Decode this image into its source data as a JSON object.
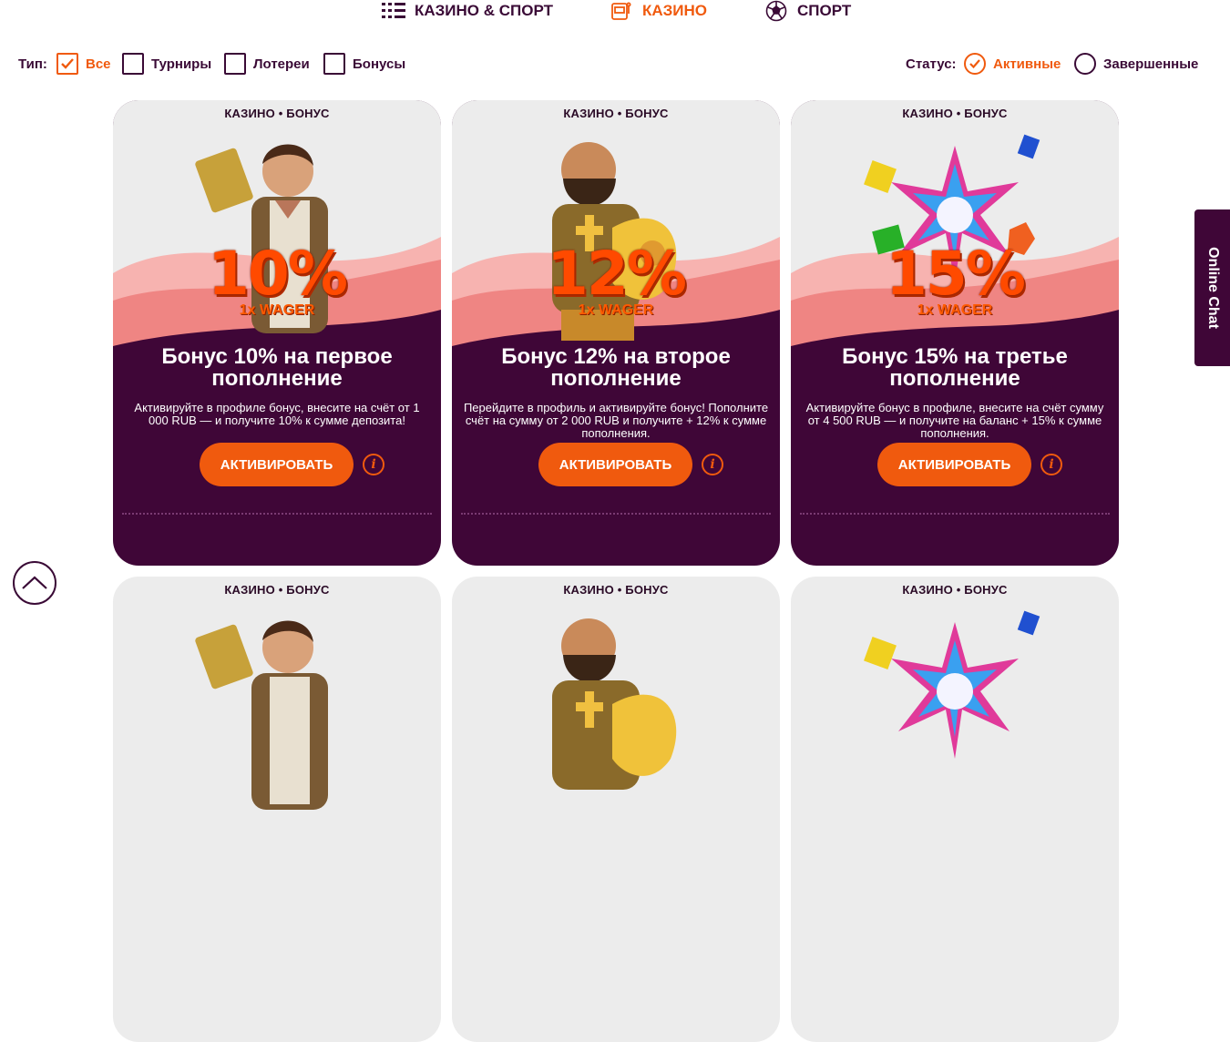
{
  "nav": {
    "items": [
      {
        "label": "КАЗИНО & СПОРТ",
        "icon": "grid-list-icon",
        "active": false
      },
      {
        "label": "КАЗИНО",
        "icon": "slot-machine-icon",
        "active": true
      },
      {
        "label": "СПОРТ",
        "icon": "soccer-ball-icon",
        "active": false
      }
    ]
  },
  "filters": {
    "type_label": "Тип:",
    "types": [
      {
        "label": "Все",
        "checked": true
      },
      {
        "label": "Турниры",
        "checked": false
      },
      {
        "label": "Лотереи",
        "checked": false
      },
      {
        "label": "Бонусы",
        "checked": false
      }
    ],
    "status_label": "Статус:",
    "statuses": [
      {
        "label": "Активные",
        "checked": true
      },
      {
        "label": "Завершенные",
        "checked": false
      }
    ]
  },
  "cards": [
    {
      "category": "КАЗИНО • БОНУС",
      "percent": "10%",
      "wager": "1x WAGER",
      "title": "Бонус 10% на первое пополнение",
      "description": "Активируйте в профиле бонус, внесите на счёт от 1 000 RUB — и получите 10% к сумме депозита!",
      "button": "АКТИВИРОВАТЬ",
      "art": "adventurer-icon"
    },
    {
      "category": "КАЗИНО • БОНУС",
      "percent": "12%",
      "wager": "1x WAGER",
      "title": "Бонус 12% на второе пополнение",
      "description": "Перейдите в профиль и активируйте бонус! Пополните счёт на сумму от 2 000 RUB и получите + 12% к сумме пополнения.",
      "button": "АКТИВИРОВАТЬ",
      "art": "dwarf-gold-icon"
    },
    {
      "category": "КАЗИНО • БОНУС",
      "percent": "15%",
      "wager": "1x WAGER",
      "title": "Бонус 15% на третье пополнение",
      "description": "Активируйте бонус в профиле, внесите на счёт сумму от 4 500 RUB — и получите на баланс + 15% к сумме пополнения.",
      "button": "АКТИВИРОВАТЬ",
      "art": "gems-star-icon"
    }
  ],
  "cards_row2": [
    {
      "category": "КАЗИНО • БОНУС",
      "art": "adventurer-icon"
    },
    {
      "category": "КАЗИНО • БОНУС",
      "art": "dwarf-gold-icon"
    },
    {
      "category": "КАЗИНО • БОНУС",
      "art": "gems-star-icon"
    }
  ],
  "chat": {
    "label": "Online Chat"
  },
  "colors": {
    "accent": "#f05a0e",
    "dark": "#3f0637",
    "card_light": "#ececec",
    "wave_pink": "#f28d8d"
  }
}
